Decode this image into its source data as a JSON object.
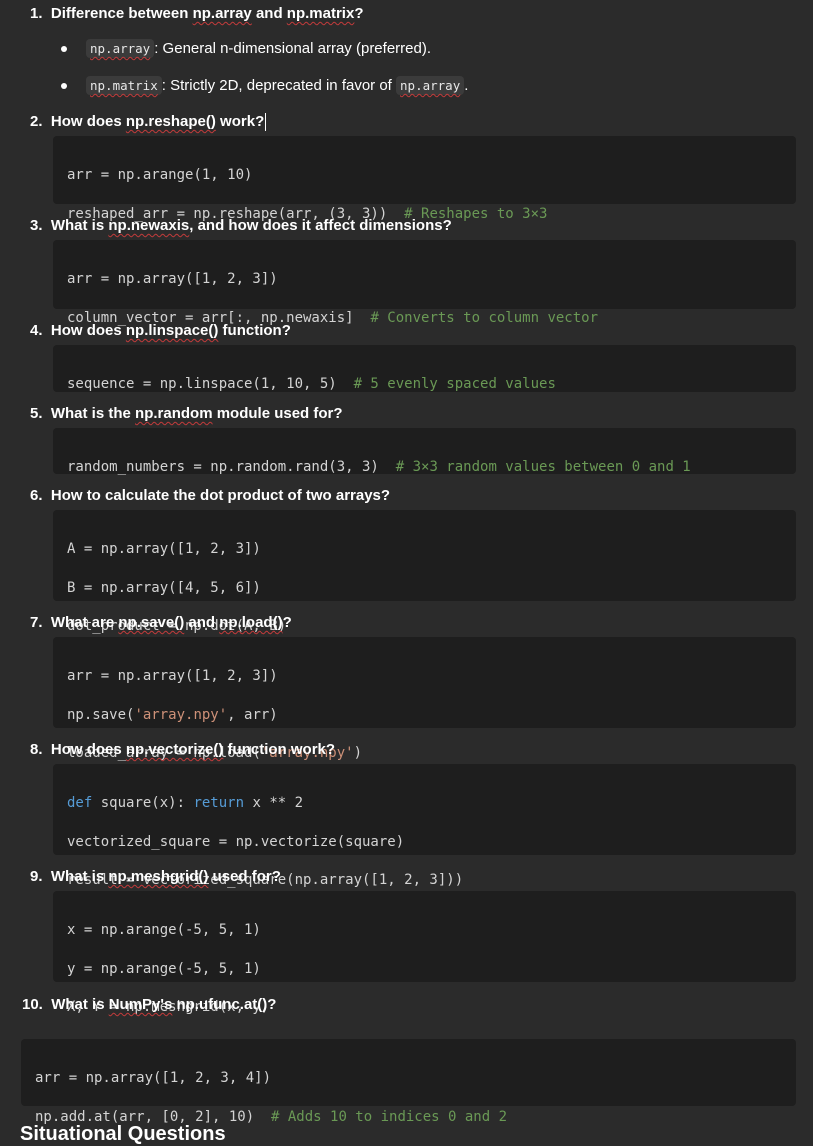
{
  "items": [
    {
      "num": "1.",
      "pre": "Difference between ",
      "term": "np.array",
      "mid": " and ",
      "term2": "np.matrix",
      "post": "?"
    },
    {
      "num": "2.",
      "pre": "How does ",
      "term": "np.reshape()",
      "post": " work?"
    },
    {
      "num": "3.",
      "pre": "What is ",
      "term": "np.newaxis",
      "post": ", and how does it affect dimensions?"
    },
    {
      "num": "4.",
      "pre": "How does ",
      "term": "np.linspace()",
      "post": " function?"
    },
    {
      "num": "5.",
      "pre": "What is the ",
      "term": "np.random",
      "post": " module used for?"
    },
    {
      "num": "6.",
      "text": "How to calculate the dot product of two arrays?"
    },
    {
      "num": "7.",
      "pre": "What are ",
      "term": "np.save()",
      "mid": " and ",
      "term2": "np.load()",
      "post": "?"
    },
    {
      "num": "8.",
      "pre": "How does ",
      "term": "np.vectorize()",
      "post": " function work?"
    },
    {
      "num": "9.",
      "pre": "What is ",
      "term": "np.meshgrid()",
      "post": " used for?"
    },
    {
      "num": "10.",
      "pre": "What is ",
      "term": "NumPy's",
      "post": " np.ufunc.at()?"
    }
  ],
  "bullets": [
    {
      "code": "np.array",
      "text": ": General n-dimensional array (preferred)."
    },
    {
      "code": "np.matrix",
      "text": ": Strictly 2D, deprecated in favor of ",
      "code2": "np.array",
      "tail": "."
    }
  ],
  "code": {
    "c2": [
      "arr = np.arange(1, 10)",
      "reshaped_arr = np.reshape(arr, (3, 3))",
      "# Reshapes to 3×3"
    ],
    "c3": [
      "arr = np.array([1, 2, 3])",
      "column_vector = arr[:, np.newaxis]",
      "# Converts to column vector"
    ],
    "c4": [
      "sequence = np.linspace(1, 10, 5)",
      "# 5 evenly spaced values"
    ],
    "c5": [
      "random_numbers = np.random.rand(3, 3)",
      "# 3×3 random values between 0 and 1"
    ],
    "c6": [
      "A = np.array([1, 2, 3])",
      "B = np.array([4, 5, 6])",
      "dot_product = np.dot(A, B)"
    ],
    "c7": [
      "arr = np.array([1, 2, 3])",
      "np.save(",
      "'array.npy'",
      ", arr)",
      "loaded_array = np.load(",
      "'array.npy'",
      ")"
    ],
    "c8": [
      "def",
      " square(x): ",
      "return",
      " x ** 2",
      "vectorized_square = np.vectorize(square)",
      "result = vectorized_square(np.array([1, 2, 3]))"
    ],
    "c9": [
      "x = np.arange(-5, 5, 1)",
      "y = np.arange(-5, 5, 1)",
      "X, Y = np.meshgrid(x, y)"
    ],
    "c10": [
      "arr = np.array([1, 2, 3, 4])",
      "np.add.at(arr, [0, 2], 10)",
      "# Adds 10 to indices 0 and 2"
    ]
  },
  "footer_partial": "Situational Questions"
}
